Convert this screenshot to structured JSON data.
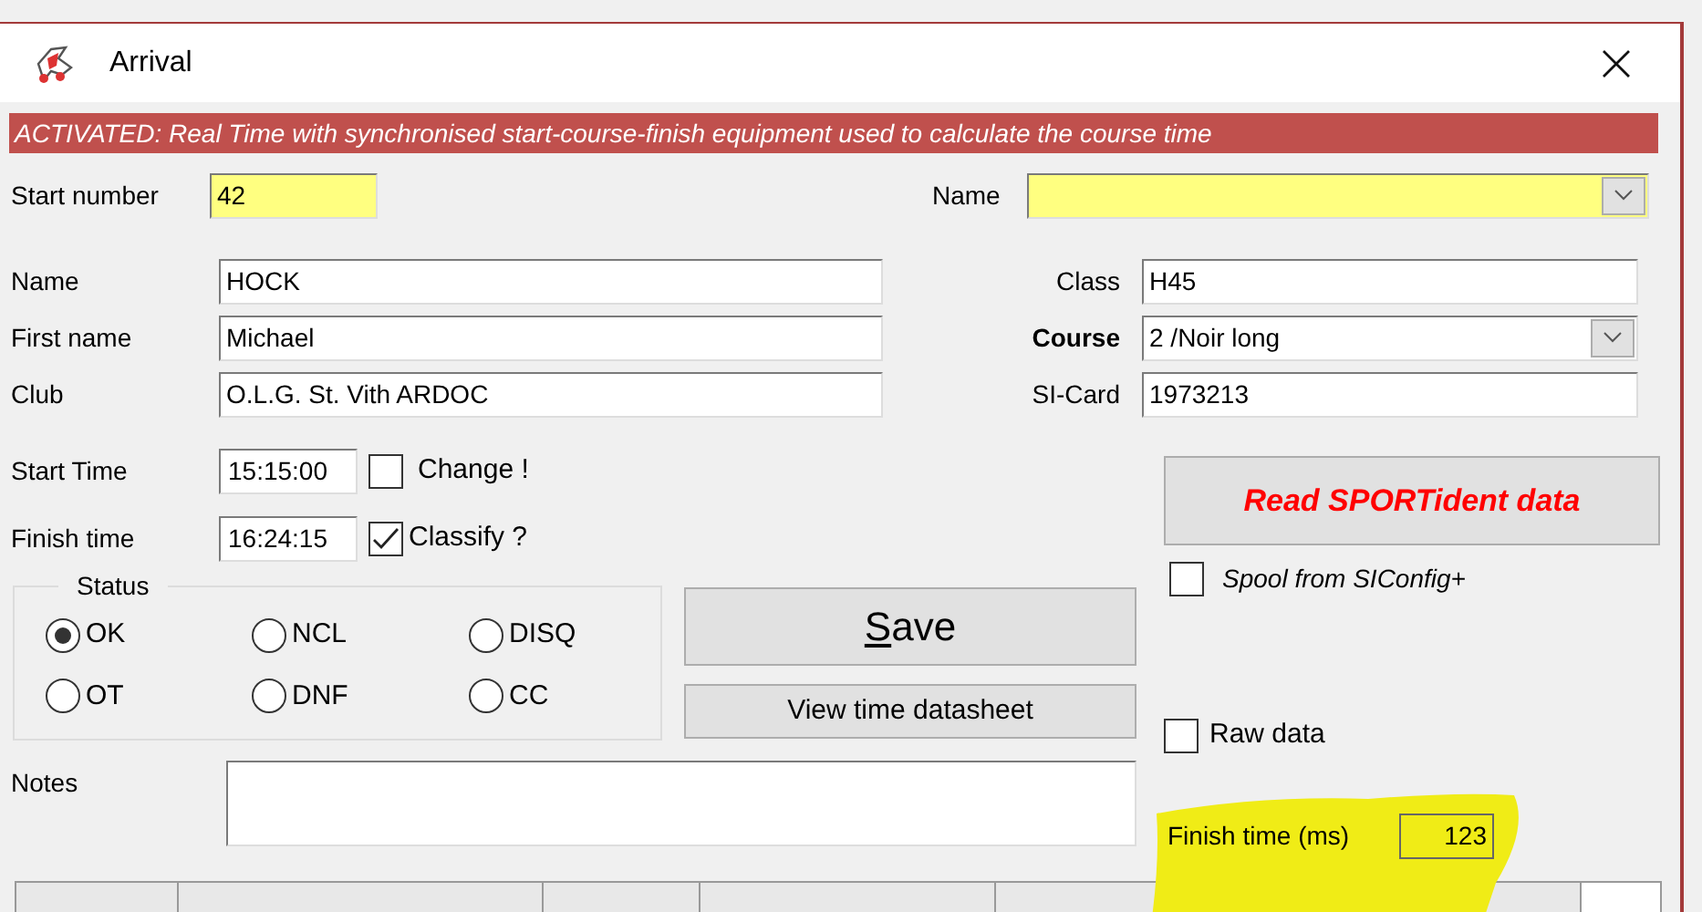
{
  "window": {
    "title": "Arrival"
  },
  "banner": "ACTIVATED: Real Time with synchronised start-course-finish equipment used to calculate the course time",
  "start_number": {
    "label": "Start number",
    "value": "42"
  },
  "name_search": {
    "label": "Name"
  },
  "fields_left": [
    {
      "label": "Name",
      "value": "HOCK"
    },
    {
      "label": "First name",
      "value": "Michael"
    },
    {
      "label": "Club",
      "value": "O.L.G. St. Vith ARDOC"
    }
  ],
  "fields_right": [
    {
      "label": "Class",
      "value": "H45",
      "kind": "text",
      "bold": false
    },
    {
      "label": "Course",
      "value": "2 /Noir long",
      "kind": "dropdown",
      "bold": true
    },
    {
      "label": "SI-Card",
      "value": "1973213",
      "kind": "text",
      "bold": false
    }
  ],
  "times": [
    {
      "label": "Start Time",
      "value": "15:15:00",
      "option": "Change !",
      "checked": false
    },
    {
      "label": "Finish time",
      "value": "16:24:15",
      "option": "Classify ?",
      "checked": true
    }
  ],
  "status": {
    "title": "Status",
    "options": [
      {
        "label": "OK",
        "selected": true
      },
      {
        "label": "NCL",
        "selected": false
      },
      {
        "label": "DISQ",
        "selected": false
      },
      {
        "label": "OT",
        "selected": false
      },
      {
        "label": "DNF",
        "selected": false
      },
      {
        "label": "CC",
        "selected": false
      }
    ]
  },
  "save_button": {
    "mnemonic": "S",
    "rest": "ave"
  },
  "datasheet_button": "View time datasheet",
  "read_button": "Read SPORTident data",
  "spool": {
    "label": "Spool from SIConfig+",
    "checked": false
  },
  "raw_data": {
    "label": "Raw data",
    "checked": false
  },
  "notes": {
    "label": "Notes"
  },
  "finish_ms": {
    "label": "Finish time (ms)",
    "value": "123",
    "highlighted": true
  }
}
